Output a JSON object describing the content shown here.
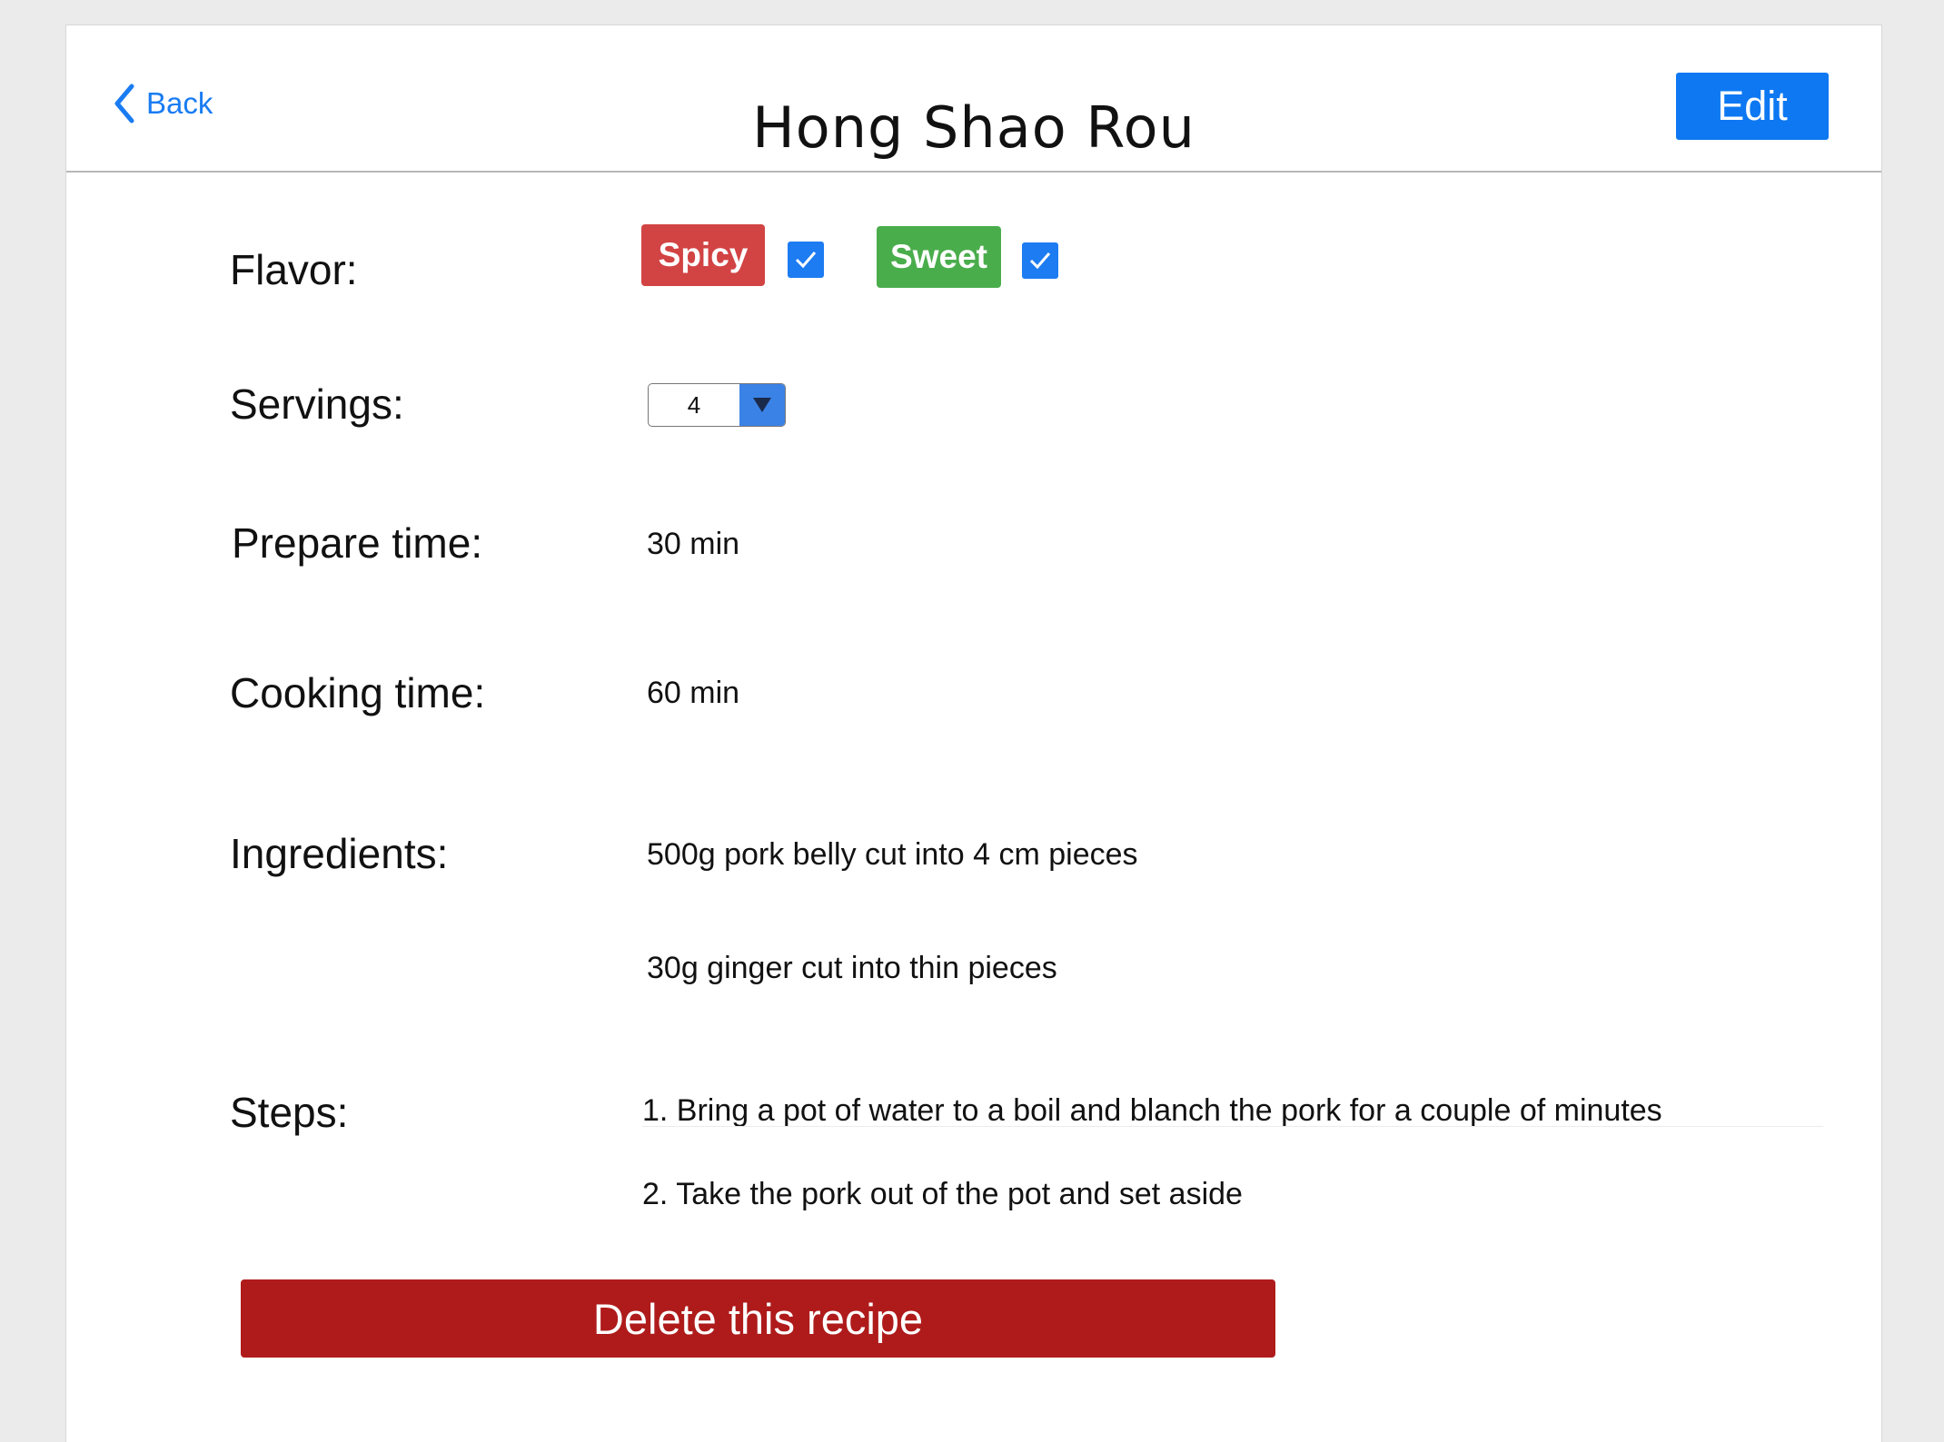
{
  "header": {
    "back_label": "Back",
    "title": "Hong Shao Rou",
    "edit_label": "Edit"
  },
  "flavor": {
    "label": "Flavor:",
    "tags": [
      {
        "name": "Spicy",
        "checked": true,
        "color": "#d24343"
      },
      {
        "name": "Sweet",
        "checked": true,
        "color": "#4aad4c"
      }
    ]
  },
  "servings": {
    "label": "Servings:",
    "selected": "4"
  },
  "prepare_time": {
    "label": "Prepare time:",
    "value": "30 min"
  },
  "cooking_time": {
    "label": "Cooking time:",
    "value": "60 min"
  },
  "ingredients": {
    "label": "Ingredients:",
    "items": [
      "500g pork belly cut into 4 cm pieces",
      "30g ginger cut into thin pieces"
    ]
  },
  "steps": {
    "label": "Steps:",
    "items": [
      "1. Bring a pot of water to a boil and blanch the pork for a couple of minutes",
      "2. Take the pork out of the pot and set aside"
    ]
  },
  "delete_label": "Delete this recipe",
  "colors": {
    "accent": "#0d78f2",
    "danger": "#af1b1b"
  }
}
